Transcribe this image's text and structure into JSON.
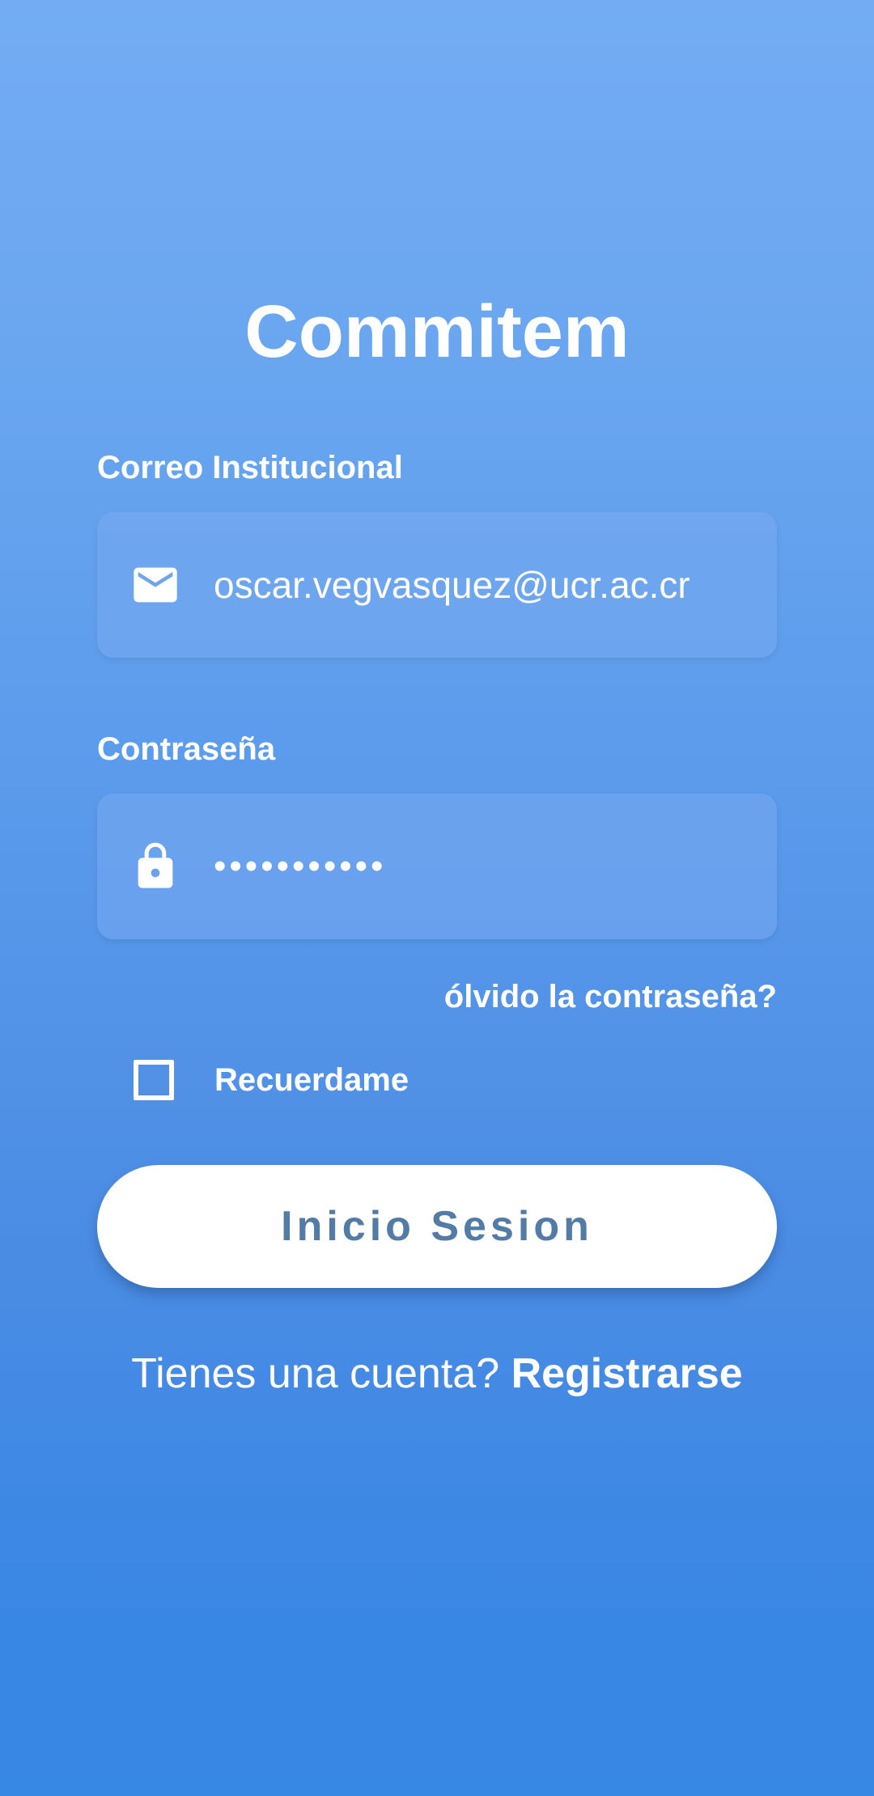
{
  "app": {
    "title": "Commitem"
  },
  "email": {
    "label": "Correo Institucional",
    "value": "oscar.vegvasquez@ucr.ac.cr",
    "icon": "mail-icon"
  },
  "password": {
    "label": "Contraseña",
    "value": "•••••••••••",
    "icon": "lock-icon"
  },
  "forgot_password": {
    "label": "ólvido la contraseña?"
  },
  "remember_me": {
    "label": "Recuerdame",
    "checked": false
  },
  "login_button": {
    "label": "Inicio Sesion"
  },
  "signup": {
    "prompt": "Tienes una cuenta? ",
    "link": "Registrarse"
  },
  "colors": {
    "gradient_top": "#73acf2",
    "gradient_bottom": "#3787e4",
    "button_text": "#527ba6",
    "text": "#ffffff"
  }
}
